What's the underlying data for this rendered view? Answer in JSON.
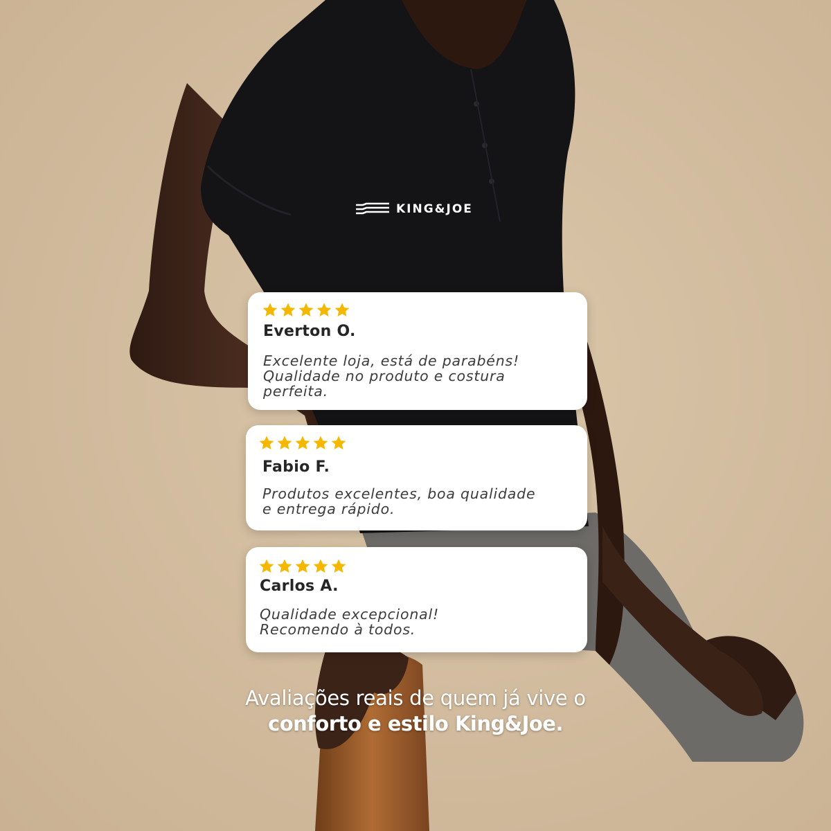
{
  "brand": {
    "logo_text": "KING&JOE",
    "logo_icon": "waves-logo-icon"
  },
  "colors": {
    "background": "#d6c0a2",
    "star": "#f5b800",
    "card": "#ffffff",
    "shirt": "#141416",
    "shorts": "#6d6b68",
    "skin": "#3a2318",
    "chair": "#9a5a28"
  },
  "reviews": [
    {
      "rating": 5,
      "name": "Everton O.",
      "text": "Excelente loja, está de parabéns!\nQualidade no produto e costura\nperfeita."
    },
    {
      "rating": 5,
      "name": "Fabio F.",
      "text": "Produtos excelentes, boa qualidade\ne entrega rápido."
    },
    {
      "rating": 5,
      "name": "Carlos A.",
      "text": "Qualidade excepcional!\nRecomendo à todos."
    }
  ],
  "tagline": {
    "line1": "Avaliações reais de quem já vive o",
    "line2": "conforto e estilo King&Joe."
  }
}
